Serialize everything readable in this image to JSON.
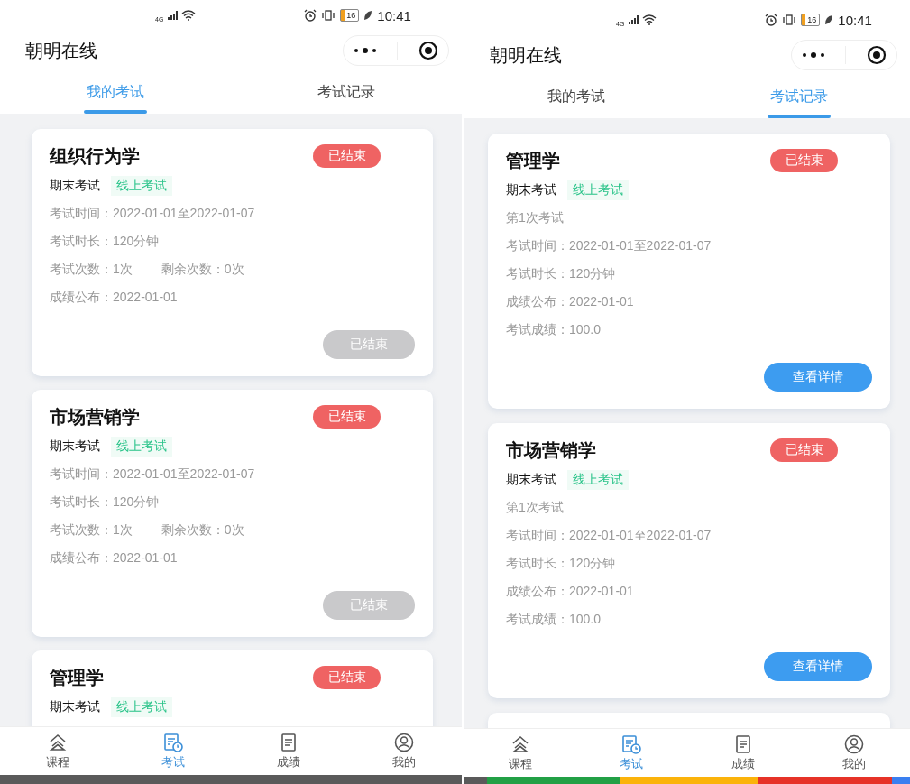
{
  "screens": [
    {
      "status_bar": {
        "network": "4G",
        "battery": "16",
        "time": "10:41"
      },
      "header": {
        "title": "朝明在线"
      },
      "tabs": [
        {
          "label": "我的考试",
          "selected": true
        },
        {
          "label": "考试记录",
          "selected": false
        }
      ],
      "cards": [
        {
          "title": "组织行为学",
          "status": "已结束",
          "exam_type": "期末考试",
          "mode": "线上考试",
          "lines": [
            [
              "考试时间：2022-01-01至2022-01-07"
            ],
            [
              "考试时长：120分钟"
            ],
            [
              "考试次数：1次",
              "剩余次数：0次"
            ],
            [
              "成绩公布：2022-01-01"
            ]
          ],
          "button": {
            "label": "已结束",
            "kind": "ended"
          }
        },
        {
          "title": "市场营销学",
          "status": "已结束",
          "exam_type": "期末考试",
          "mode": "线上考试",
          "lines": [
            [
              "考试时间：2022-01-01至2022-01-07"
            ],
            [
              "考试时长：120分钟"
            ],
            [
              "考试次数：1次",
              "剩余次数：0次"
            ],
            [
              "成绩公布：2022-01-01"
            ]
          ],
          "button": {
            "label": "已结束",
            "kind": "ended"
          }
        },
        {
          "title": "管理学",
          "status": "已结束",
          "exam_type": "期末考试",
          "mode": "线上考试"
        }
      ],
      "nav": [
        {
          "label": "课程",
          "selected": false
        },
        {
          "label": "考试",
          "selected": true
        },
        {
          "label": "成绩",
          "selected": false
        },
        {
          "label": "我的",
          "selected": false
        }
      ]
    },
    {
      "status_bar": {
        "network": "4G",
        "battery": "16",
        "time": "10:41"
      },
      "header": {
        "title": "朝明在线"
      },
      "tabs": [
        {
          "label": "我的考试",
          "selected": false
        },
        {
          "label": "考试记录",
          "selected": true
        }
      ],
      "cards": [
        {
          "title": "管理学",
          "status": "已结束",
          "exam_type": "期末考试",
          "mode": "线上考试",
          "lines": [
            [
              "第1次考试"
            ],
            [
              "考试时间：2022-01-01至2022-01-07"
            ],
            [
              "考试时长：120分钟"
            ],
            [
              "成绩公布：2022-01-01"
            ],
            [
              "考试成绩：100.0"
            ]
          ],
          "button": {
            "label": "查看详情",
            "kind": "detail"
          }
        },
        {
          "title": "市场营销学",
          "status": "已结束",
          "exam_type": "期末考试",
          "mode": "线上考试",
          "lines": [
            [
              "第1次考试"
            ],
            [
              "考试时间：2022-01-01至2022-01-07"
            ],
            [
              "考试时长：120分钟"
            ],
            [
              "成绩公布：2022-01-01"
            ],
            [
              "考试成绩：100.0"
            ]
          ],
          "button": {
            "label": "查看详情",
            "kind": "detail"
          }
        },
        {
          "kind": "cut_off"
        }
      ],
      "nav": [
        {
          "label": "课程",
          "selected": false
        },
        {
          "label": "考试",
          "selected": true
        },
        {
          "label": "成绩",
          "selected": false
        },
        {
          "label": "我的",
          "selected": false
        }
      ]
    }
  ]
}
